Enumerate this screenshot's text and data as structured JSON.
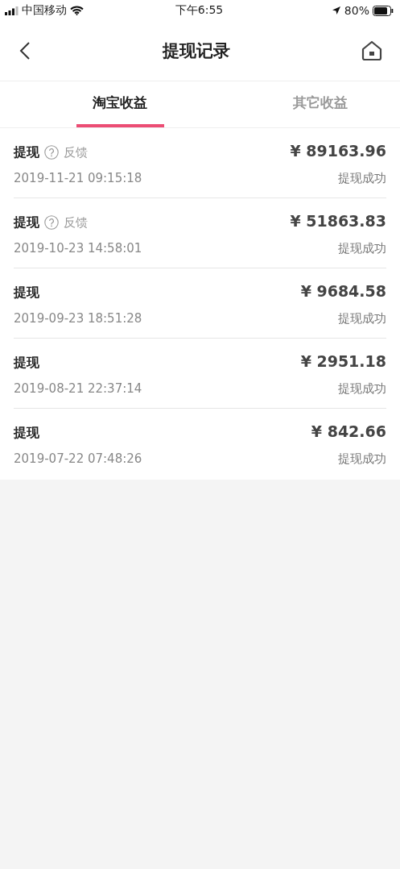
{
  "status_bar": {
    "carrier": "中国移动",
    "time": "下午6:55",
    "battery": "80%"
  },
  "nav": {
    "title": "提现记录"
  },
  "tabs": [
    {
      "label": "淘宝收益",
      "selected": true
    },
    {
      "label": "其它收益",
      "selected": false
    }
  ],
  "records": [
    {
      "title": "提现",
      "feedback": "反馈",
      "date": "2019-11-21 09:15:18",
      "amount": "¥ 89163.96",
      "status": "提现成功"
    },
    {
      "title": "提现",
      "feedback": "反馈",
      "date": "2019-10-23 14:58:01",
      "amount": "¥ 51863.83",
      "status": "提现成功"
    },
    {
      "title": "提现",
      "date": "2019-09-23 18:51:28",
      "amount": "¥ 9684.58",
      "status": "提现成功"
    },
    {
      "title": "提现",
      "date": "2019-08-21 22:37:14",
      "amount": "¥ 2951.18",
      "status": "提现成功"
    },
    {
      "title": "提现",
      "date": "2019-07-22 07:48:26",
      "amount": "¥ 842.66",
      "status": "提现成功"
    }
  ]
}
